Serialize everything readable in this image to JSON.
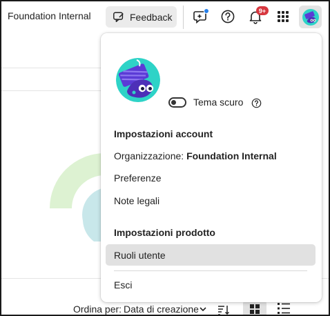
{
  "topbar": {
    "org_name": "Foundation Internal",
    "feedback_label": "Feedback",
    "notifications_badge": "9+"
  },
  "background": {
    "sort_label": "Ordina per:",
    "sort_value": "Data di creazione"
  },
  "popover": {
    "dark_theme_label": "Tema scuro",
    "account_settings_heading": "Impostazioni account",
    "organization_label": "Organizzazione:",
    "organization_value": "Foundation Internal",
    "preferences": "Preferenze",
    "legal_notes": "Note legali",
    "product_settings_heading": "Impostazioni prodotto",
    "user_roles": "Ruoli utente",
    "sign_out": "Esci"
  },
  "colors": {
    "badge_red": "#d7373f",
    "dot_blue": "#2680eb",
    "selected_bg": "#e1e1e1",
    "avatar_teal": "#2ed3c7",
    "avatar_purple": "#5b3bd6"
  }
}
